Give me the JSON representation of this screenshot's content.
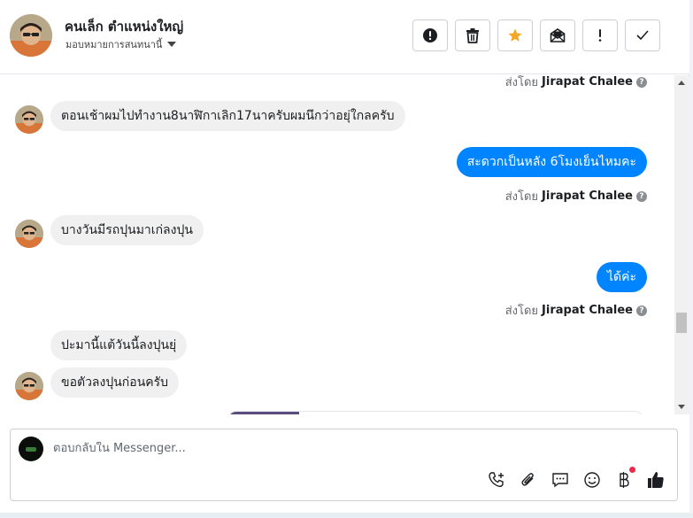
{
  "header": {
    "contact_name": "คนเล็ก ตำแหน่งใหญ่",
    "assign_label": "มอบหมายการสนทนานี้",
    "actions": [
      "mark-as-spam",
      "delete",
      "star",
      "mark-as-unread",
      "follow-up",
      "mark-as-done"
    ]
  },
  "messages": [
    {
      "direction": "out",
      "sent_by_prefix": "ส่งโดย",
      "sent_by": "Jirapat Chalee",
      "text": ""
    },
    {
      "direction": "in",
      "text": "ตอนเช้าผมไปทำงาน8นาฬิกาเลิก17นาครับผมนึกว่าอยุ่ใกลครับ"
    },
    {
      "direction": "out",
      "text": "สะดวกเป็นหลัง 6โมงเย็นไหมคะ",
      "sent_by_prefix": "ส่งโดย",
      "sent_by": "Jirapat Chalee"
    },
    {
      "direction": "in",
      "text": "บางวันมีรถปุนมาเก่ลงปุน"
    },
    {
      "direction": "out",
      "text": "ได้ค่ะ",
      "sent_by_prefix": "ส่งโดย",
      "sent_by": "Jirapat Chalee"
    },
    {
      "direction": "in",
      "text": "ปะมานี้แต้วันนี้ลงปุนยุ่"
    },
    {
      "direction": "in",
      "text": "ขอตัวลงปุนก่อนครับ"
    }
  ],
  "help_glyph": "?",
  "composer": {
    "placeholder": "ตอบกลับใน Messenger...",
    "value": "",
    "tools": [
      "call-plus-icon",
      "paperclip-icon",
      "saved-reply-icon",
      "emoji-icon",
      "baht-payment-icon",
      "thumbs-up-icon"
    ]
  },
  "colors": {
    "outgoing_bubble": "#0084ff",
    "incoming_bubble": "#f0f0f0",
    "star": "#f5a623",
    "notification_dot": "#f02849"
  }
}
